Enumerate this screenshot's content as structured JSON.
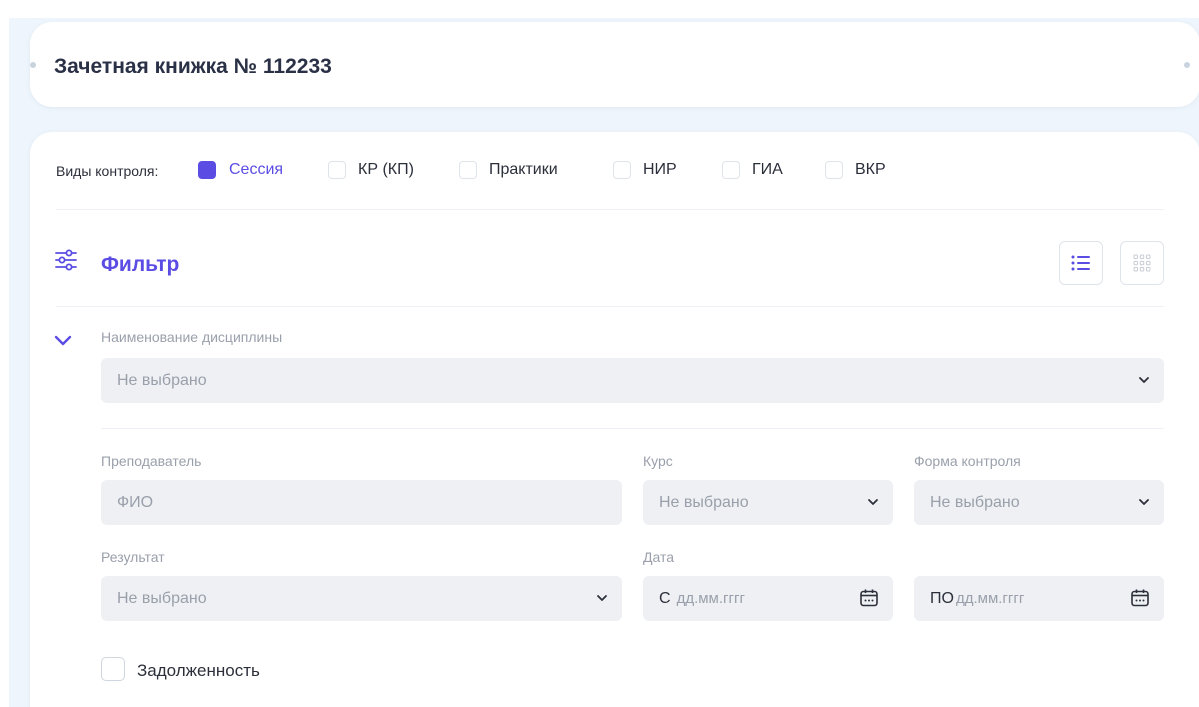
{
  "header": {
    "title": "Зачетная книжка № 112233"
  },
  "control_types": {
    "label": "Виды контроля:",
    "items": [
      {
        "label": "Сессия",
        "checked": true
      },
      {
        "label": "КР (КП)",
        "checked": false
      },
      {
        "label": "Практики",
        "checked": false
      },
      {
        "label": "НИР",
        "checked": false
      },
      {
        "label": "ГИА",
        "checked": false
      },
      {
        "label": "ВКР",
        "checked": false
      }
    ]
  },
  "filter": {
    "title": "Фильтр",
    "discipline": {
      "label": "Наименование дисциплины",
      "value": "Не выбрано"
    },
    "teacher": {
      "label": "Преподаватель",
      "placeholder": "ФИО"
    },
    "course": {
      "label": "Курс",
      "value": "Не выбрано"
    },
    "control_form": {
      "label": "Форма контроля",
      "value": "Не выбрано"
    },
    "result": {
      "label": "Результат",
      "value": "Не выбрано"
    },
    "date": {
      "label": "Дата",
      "from_prefix": "С",
      "from_placeholder": "дд.мм.гггг",
      "to_prefix": "ПО",
      "to_placeholder": "дд.мм.гггг"
    },
    "debt": {
      "label": "Задолженность",
      "checked": false
    }
  },
  "colors": {
    "accent": "#5b4de3",
    "page_bg": "#eef5fc",
    "field_bg": "#eef0f3",
    "muted_text": "#9aa0ab"
  },
  "icons": {
    "filter": "sliders-icon",
    "view_list": "list-view-icon",
    "view_grid": "grid-view-icon",
    "collapse": "chevron-down-icon",
    "select_arrow": "chevron-down-icon",
    "date_picker": "calendar-icon"
  }
}
